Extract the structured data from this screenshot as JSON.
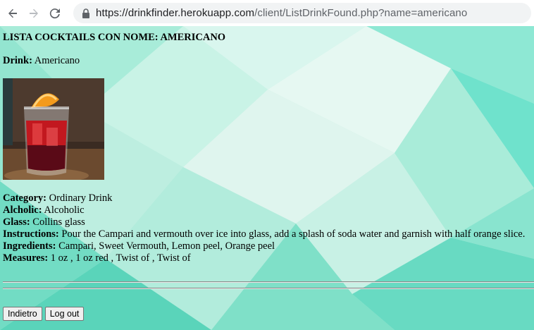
{
  "browser": {
    "url_host": "https://drinkfinder.herokuapp.com",
    "url_path": "/client/ListDrinkFound.php?name=americano"
  },
  "page": {
    "heading": "LISTA COCKTAILS CON NOME: AMERICANO",
    "drink_label": "Drink:",
    "drink_value": "Americano",
    "details": [
      {
        "label": "Category:",
        "value": "Ordinary Drink"
      },
      {
        "label": "Alcholic:",
        "value": "Alcoholic"
      },
      {
        "label": "Glass:",
        "value": "Collins glass"
      },
      {
        "label": "Instructions:",
        "value": "Pour the Campari and vermouth over ice into glass, add a splash of soda water and garnish with half orange slice."
      },
      {
        "label": "Ingredients:",
        "value": "Campari, Sweet Vermouth, Lemon peel, Orange peel"
      },
      {
        "label": "Measures:",
        "value": "1 oz , 1 oz red , Twist of , Twist of"
      }
    ],
    "buttons": {
      "back": "Indietro",
      "logout": "Log out"
    }
  }
}
